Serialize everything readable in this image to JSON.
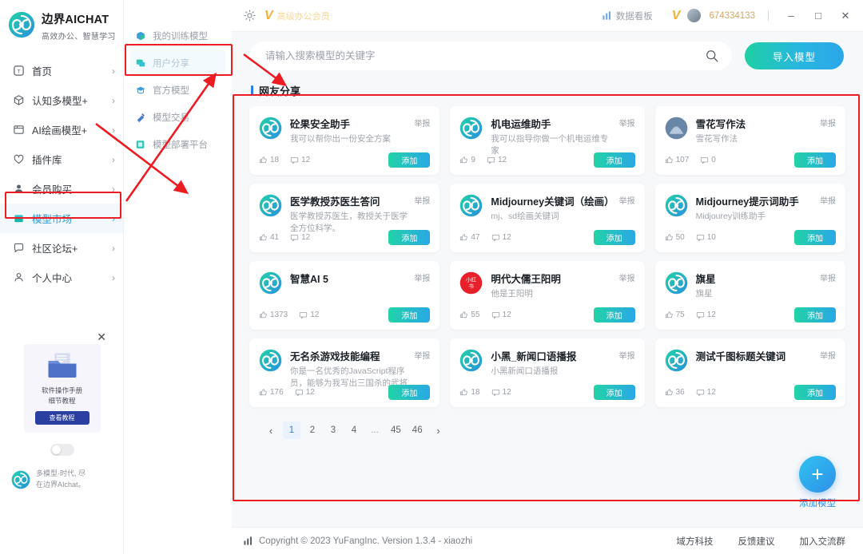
{
  "brand": {
    "title": "边界AICHAT",
    "subtitle": "高效办公、智慧学习",
    "logo_icon": "spiral-logo-icon"
  },
  "sidebar": {
    "items": [
      {
        "label": "首页",
        "icon": "home-icon",
        "chevron": "›",
        "active": false
      },
      {
        "label": "认知多模型+",
        "icon": "cube-icon",
        "chevron": "›",
        "active": false
      },
      {
        "label": "AI绘画模型+",
        "icon": "image-icon",
        "chevron": "›",
        "active": false
      },
      {
        "label": "插件库",
        "icon": "heart-icon",
        "chevron": "›",
        "active": false
      },
      {
        "label": "会员购买",
        "icon": "user-badge-icon",
        "chevron": "›",
        "active": false
      },
      {
        "label": "模型市场",
        "icon": "market-icon",
        "chevron": "›",
        "active": true
      },
      {
        "label": "社区论坛+",
        "icon": "chat-bubble-icon",
        "chevron": "›",
        "active": false
      },
      {
        "label": "个人中心",
        "icon": "person-icon",
        "chevron": "›",
        "active": false
      }
    ],
    "promo": {
      "close_icon": "close-icon",
      "folder_icon": "folder-icon",
      "line1": "软件操作手册",
      "line2": "细节教程",
      "button": "查看教程"
    },
    "footer_brand": {
      "logo_icon": "spiral-logo-icon",
      "line1": "多模型·时代, 尽",
      "line2": "在边界AIchat。"
    }
  },
  "submenu": {
    "items": [
      {
        "label": "我的训练模型",
        "icon": "box-icon",
        "highlight": false
      },
      {
        "label": "用户分享",
        "icon": "share-icon",
        "highlight": true
      },
      {
        "label": "官方模型",
        "icon": "cap-icon",
        "highlight": false
      },
      {
        "label": "模型交易",
        "icon": "trade-icon",
        "highlight": false
      },
      {
        "label": "模型部署平台",
        "icon": "deploy-icon",
        "highlight": false
      }
    ]
  },
  "titlebar": {
    "gear_icon": "gear-icon",
    "vip_mark": "V",
    "vip_label": "高级办公会员",
    "dashboard": {
      "label": "数据看板",
      "icon": "bar-chart-icon"
    },
    "vip_mark_right": "V",
    "avatar": "user-avatar",
    "user_id": "674334133",
    "window": {
      "minimize": "–",
      "maximize": "□",
      "close": "✕"
    }
  },
  "search": {
    "placeholder": "请输入搜索模型的关键字",
    "value": "",
    "search_icon": "search-icon",
    "import_button": "导入模型"
  },
  "section": {
    "title": "网友分享"
  },
  "cards": [
    {
      "title": "砼果安全助手",
      "desc": "我可以帮你出一份安全方案",
      "likes": "18",
      "comments": "12",
      "report": "举报",
      "add": "添加",
      "avatar": "spiral-logo-icon"
    },
    {
      "title": "机电运维助手",
      "desc": "我可以指导你做一个机电运维专家",
      "likes": "9",
      "comments": "12",
      "report": "举报",
      "add": "添加",
      "avatar": "spiral-logo-icon"
    },
    {
      "title": "雪花写作法",
      "desc": "雪花写作法",
      "likes": "107",
      "comments": "0",
      "report": "举报",
      "add": "添加",
      "avatar": "photo-avatar"
    },
    {
      "title": "医学教授苏医生答问",
      "desc": "医学教授苏医生，教授关于医学全方位科学。",
      "likes": "41",
      "comments": "12",
      "report": "举报",
      "add": "添加",
      "avatar": "spiral-logo-icon"
    },
    {
      "title": "Midjourney关键词（绘画）",
      "desc": "mj、sd绘画关键词",
      "likes": "47",
      "comments": "12",
      "report": "举报",
      "add": "添加",
      "avatar": "spiral-logo-icon"
    },
    {
      "title": "Midjourney提示词助手",
      "desc": "Midjourey训练助手",
      "likes": "50",
      "comments": "10",
      "report": "举报",
      "add": "添加",
      "avatar": "spiral-logo-icon"
    },
    {
      "title": "智慧AI 5",
      "desc": "",
      "likes": "1373",
      "comments": "12",
      "report": "举报",
      "add": "添加",
      "avatar": "spiral-logo-icon"
    },
    {
      "title": "明代大儒王阳明",
      "desc": "他是王阳明",
      "likes": "55",
      "comments": "12",
      "report": "举报",
      "add": "添加",
      "avatar": "xiaohongshu-avatar"
    },
    {
      "title": "旗星",
      "desc": "旗星",
      "likes": "75",
      "comments": "12",
      "report": "举报",
      "add": "添加",
      "avatar": "spiral-logo-icon"
    },
    {
      "title": "无名杀游戏技能编程",
      "desc": "你是一名优秀的JavaScript程序员，能够为我写出三国杀的武将技能…",
      "likes": "176",
      "comments": "12",
      "report": "举报",
      "add": "添加",
      "avatar": "spiral-logo-icon"
    },
    {
      "title": "小黑_新闻口语播报",
      "desc": "小黑新闻口语播报",
      "likes": "18",
      "comments": "12",
      "report": "举报",
      "add": "添加",
      "avatar": "spiral-logo-icon"
    },
    {
      "title": "测试千图标题关键词",
      "desc": "",
      "likes": "36",
      "comments": "12",
      "report": "举报",
      "add": "添加",
      "avatar": "spiral-logo-icon"
    }
  ],
  "pagination": {
    "prev": "‹",
    "next": "›",
    "pages": [
      "1",
      "2",
      "3",
      "4",
      "...",
      "45",
      "46"
    ],
    "current": "1"
  },
  "fab": {
    "plus": "+",
    "label": "添加模型"
  },
  "footer": {
    "icon": "bar-chart-icon",
    "copyright": "Copyright © 2023 YuFangInc. Version 1.3.4 - xiaozhi",
    "links": [
      "域方科技",
      "反馈建议",
      "加入交流群"
    ]
  },
  "colors": {
    "accent_blue": "#2f8fe8",
    "accent_green": "#22d3a6",
    "annotation_red": "#ec1c24",
    "gold": "#f0b23c"
  }
}
